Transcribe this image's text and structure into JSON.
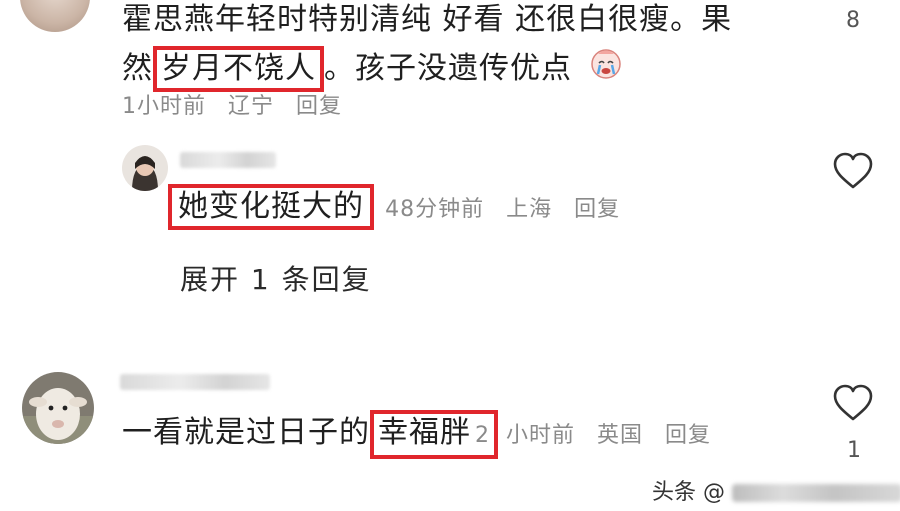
{
  "comment1": {
    "line1": "霍思燕年轻时特别清纯 好看 还很白很瘦。果",
    "line2_prefix": "然",
    "line2_highlight": "岁月不饶人",
    "line2_suffix": "。孩子没遗传优点",
    "emoji": "crying-face-emoji",
    "time": "1小时前",
    "location": "辽宁",
    "reply_label": "回复",
    "likes": "8"
  },
  "reply1": {
    "highlight": "她变化挺大的",
    "time": "48分钟前",
    "location": "上海",
    "reply_label": "回复"
  },
  "expand_label": "展开 1 条回复",
  "comment2": {
    "text_prefix": "一看就是过日子的",
    "highlight": "幸福胖",
    "time_digit": "2",
    "time_rest": "小时前",
    "location": "英国",
    "reply_label": "回复",
    "likes": "1"
  },
  "watermark": {
    "label": "头条",
    "at": "@"
  },
  "colors": {
    "highlight_box": "#e0262c",
    "meta": "#8a8a8a"
  }
}
